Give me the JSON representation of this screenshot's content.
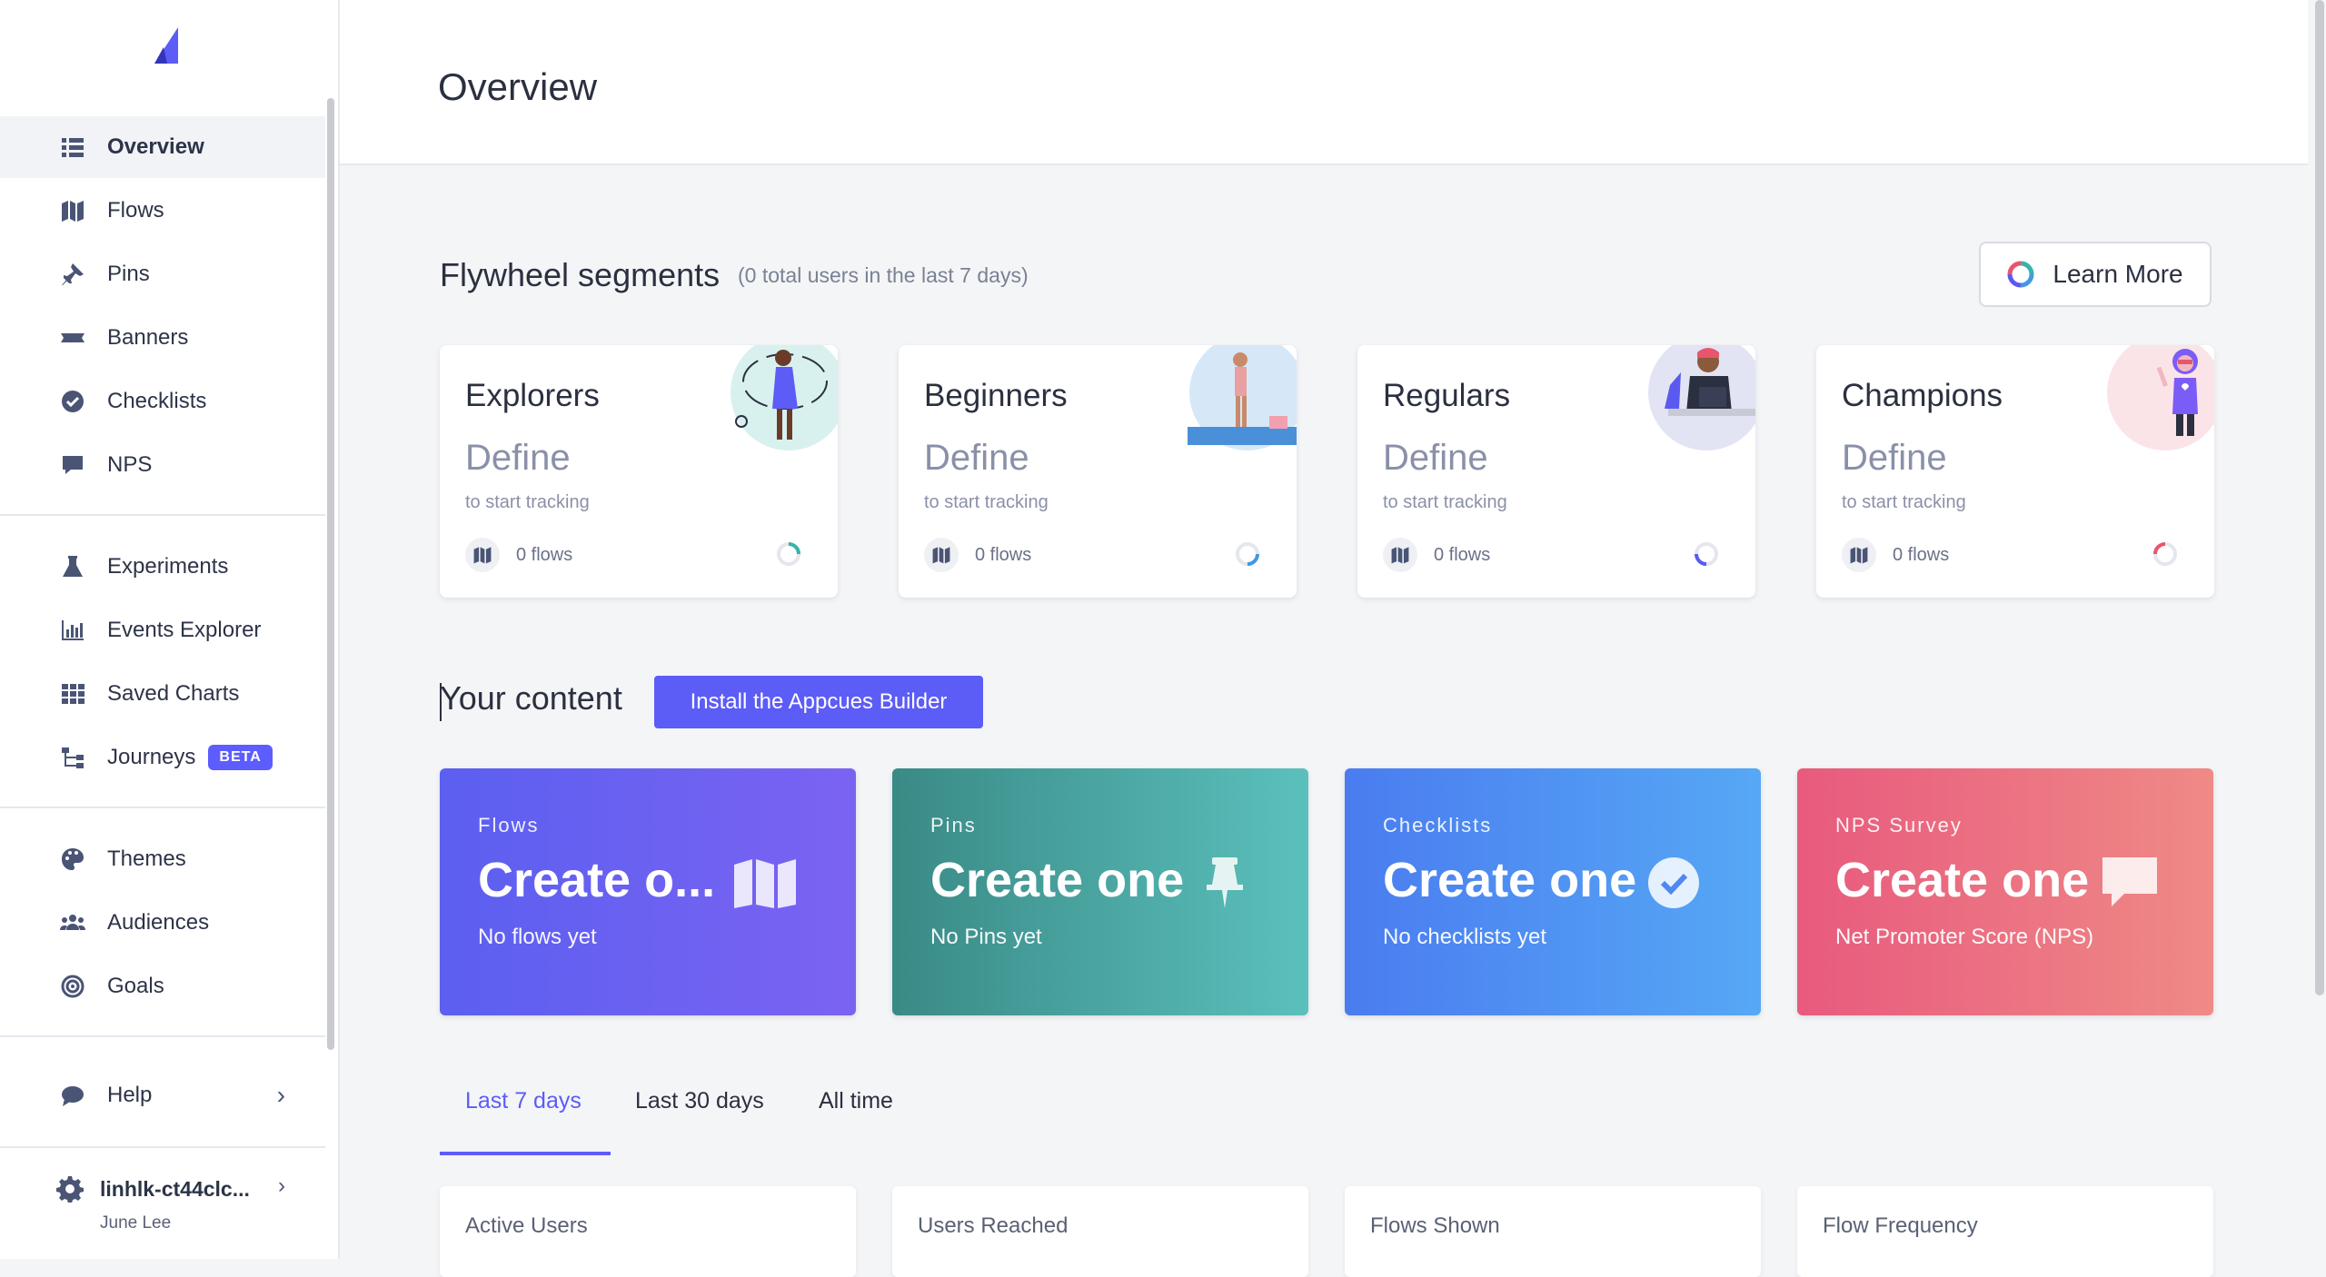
{
  "sidebar": {
    "items": [
      {
        "label": "Overview",
        "icon": "list-icon"
      },
      {
        "label": "Flows",
        "icon": "map-icon"
      },
      {
        "label": "Pins",
        "icon": "pin-icon"
      },
      {
        "label": "Banners",
        "icon": "banner-icon"
      },
      {
        "label": "Checklists",
        "icon": "check-circle-icon"
      },
      {
        "label": "NPS",
        "icon": "comment-icon"
      },
      {
        "label": "Experiments",
        "icon": "flask-icon"
      },
      {
        "label": "Events Explorer",
        "icon": "bar-chart-icon"
      },
      {
        "label": "Saved Charts",
        "icon": "grid-icon"
      },
      {
        "label": "Journeys",
        "icon": "sitemap-icon",
        "badge": "BETA"
      },
      {
        "label": "Themes",
        "icon": "palette-icon"
      },
      {
        "label": "Audiences",
        "icon": "users-icon"
      },
      {
        "label": "Goals",
        "icon": "target-icon"
      },
      {
        "label": "Help",
        "icon": "chat-icon"
      }
    ],
    "account": {
      "name": "linhlk-ct44clc...",
      "user": "June Lee"
    }
  },
  "header": {
    "title": "Overview"
  },
  "flywheel": {
    "title": "Flywheel segments",
    "subtitle": "(0 total users in the last 7 days)",
    "learn_more": "Learn More",
    "segments": [
      {
        "name": "Explorers",
        "define": "Define",
        "hint": "to start tracking",
        "flows": "0 flows",
        "color": "#38b2ac"
      },
      {
        "name": "Beginners",
        "define": "Define",
        "hint": "to start tracking",
        "flows": "0 flows",
        "color": "#4299e1"
      },
      {
        "name": "Regulars",
        "define": "Define",
        "hint": "to start tracking",
        "flows": "0 flows",
        "color": "#5a5af0"
      },
      {
        "name": "Champions",
        "define": "Define",
        "hint": "to start tracking",
        "flows": "0 flows",
        "color": "#e8556d"
      }
    ]
  },
  "content": {
    "title": "Your content",
    "install": "Install the Appcues Builder",
    "cards": [
      {
        "category": "Flows",
        "title": "Create o...",
        "sub": "No flows yet",
        "icon": "map-icon",
        "from": "#5b5ff0",
        "to": "#7b63f2"
      },
      {
        "category": "Pins",
        "title": "Create one",
        "sub": "No Pins yet",
        "icon": "pin-icon",
        "from": "#3a8a86",
        "to": "#5bc0bc"
      },
      {
        "category": "Checklists",
        "title": "Create one",
        "sub": "No checklists yet",
        "icon": "check-circle-icon",
        "from": "#4a7cf0",
        "to": "#56a8f5"
      },
      {
        "category": "NPS Survey",
        "title": "Create one",
        "sub": "Net Promoter Score (NPS)",
        "icon": "comment-icon",
        "from": "#e85a7e",
        "to": "#ef8a86"
      }
    ]
  },
  "tabs": [
    "Last 7 days",
    "Last 30 days",
    "All time"
  ],
  "stats": [
    {
      "label": "Active Users"
    },
    {
      "label": "Users Reached"
    },
    {
      "label": "Flows Shown"
    },
    {
      "label": "Flow Frequency"
    }
  ]
}
